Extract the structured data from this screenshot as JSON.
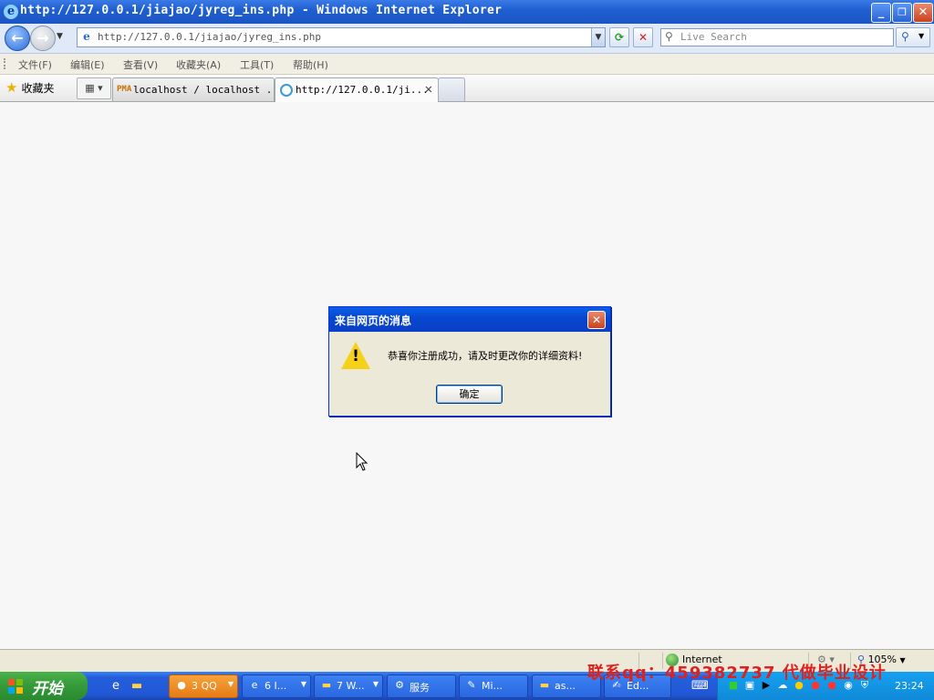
{
  "window": {
    "title": "http://127.0.0.1/jiajao/jyreg_ins.php - Windows Internet Explorer",
    "minimize_glyph": "_",
    "restore_glyph": "❐",
    "close_glyph": "✕"
  },
  "address_bar": {
    "url": "http://127.0.0.1/jiajao/jyreg_ins.php",
    "search_placeholder": "Live Search"
  },
  "menu": {
    "items": [
      "文件(F)",
      "编辑(E)",
      "查看(V)",
      "收藏夹(A)",
      "工具(T)",
      "帮助(H)"
    ]
  },
  "favorites": {
    "label": "收藏夹"
  },
  "tabs": [
    {
      "label": "localhost / localhost ...",
      "icon": "phpmyadmin-icon",
      "icon_text": "PMA"
    },
    {
      "label": "http://127.0.0.1/ji...",
      "icon": "ie-icon",
      "close": "✕"
    }
  ],
  "dialog": {
    "title": "来自网页的消息",
    "message": "恭喜你注册成功，请及时更改你的详细资料!",
    "ok_label": "确定",
    "close_glyph": "✕",
    "warning_mark": "!"
  },
  "status_bar": {
    "zone": "Internet",
    "zoom": "105%"
  },
  "taskbar": {
    "start_label": "开始",
    "tasks": [
      {
        "label": "3 QQ",
        "icon": "qq-icon"
      },
      {
        "label": "6 I...",
        "icon": "ie-icon"
      },
      {
        "label": "7 W...",
        "icon": "folder-icon"
      },
      {
        "label": "服务",
        "icon": "services-icon"
      },
      {
        "label": "Mi...",
        "icon": "tools-icon"
      },
      {
        "label": "as...",
        "icon": "folder-icon"
      },
      {
        "label": "Ed...",
        "icon": "editor-icon"
      }
    ],
    "clock": "23:24"
  },
  "watermark": "联系qq：459382737 代做毕业设计",
  "colors": {
    "titlebar": "#1f5fd0",
    "dialog_border": "#0831d9",
    "watermark": "#e0201c",
    "start_green": "#35993a"
  }
}
